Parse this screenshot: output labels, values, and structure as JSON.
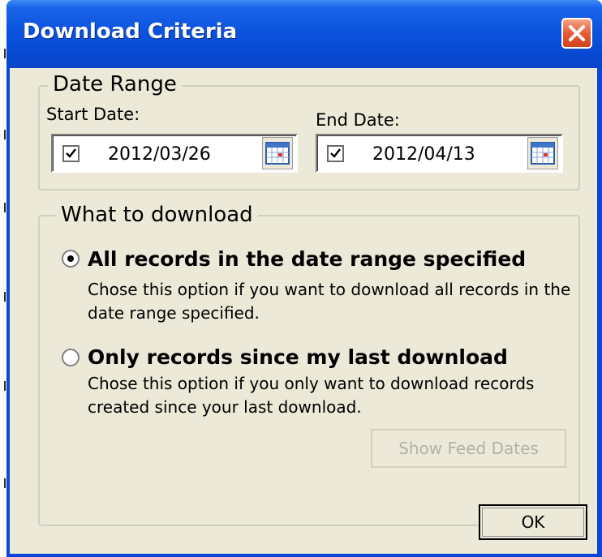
{
  "window": {
    "title": "Download Criteria",
    "close_icon": "close-x"
  },
  "date_range": {
    "legend": "Date Range",
    "start": {
      "label": "Start Date:",
      "value": "2012/03/26",
      "checked": true,
      "icon": "calendar-icon"
    },
    "end": {
      "label": "End Date:",
      "value": "2012/04/13",
      "checked": true,
      "icon": "calendar-icon"
    }
  },
  "what_to_download": {
    "legend": "What to download",
    "options": [
      {
        "label": "All records in the date range specified",
        "description": "Chose this option if you want to download all records in the date range specified.",
        "selected": true
      },
      {
        "label": "Only records since my last download",
        "description": "Chose this option if you only want to download records created since your last download.",
        "selected": false
      }
    ],
    "show_feed_dates_label": "Show Feed Dates",
    "show_feed_dates_enabled": false
  },
  "footer": {
    "ok_label": "OK"
  },
  "colors": {
    "titlebar": "#0a52dd",
    "client": "#ece9d8",
    "close_button": "#e4572d"
  }
}
